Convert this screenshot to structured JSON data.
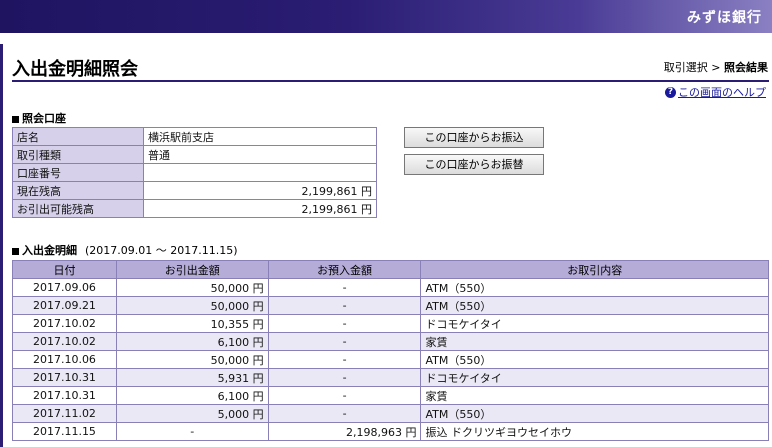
{
  "header": {
    "bank_name": "みずほ銀行"
  },
  "page": {
    "title": "入出金明細照会",
    "breadcrumb_prev": "取引選択",
    "breadcrumb_sep": " > ",
    "breadcrumb_current": "照会結果",
    "help_link": "この画面のヘルプ"
  },
  "account": {
    "heading": "照会口座",
    "rows": [
      {
        "label": "店名",
        "value": ""
      },
      {
        "label": "取引種類",
        "value": ""
      },
      {
        "label": "口座番号",
        "value": ""
      },
      {
        "label": "現在残高",
        "value": "2,199,861 円"
      },
      {
        "label": "お引出可能残高",
        "value": "2,199,861 円"
      }
    ],
    "branch": "横浜駅前支店",
    "type": "普通",
    "number": ""
  },
  "buttons": {
    "transfer_furikomi": "この口座からお振込",
    "transfer_furikae": "この口座からお振替"
  },
  "transactions": {
    "heading": "入出金明細",
    "period": "(2017.09.01 〜 2017.11.15)",
    "columns": [
      "日付",
      "お引出金額",
      "お預入金額",
      "お取引内容"
    ],
    "rows": [
      {
        "date": "2017.09.06",
        "withdrawal": "50,000 円",
        "deposit": "-",
        "desc": "ATM（550）"
      },
      {
        "date": "2017.09.21",
        "withdrawal": "50,000 円",
        "deposit": "-",
        "desc": "ATM（550）"
      },
      {
        "date": "2017.10.02",
        "withdrawal": "10,355 円",
        "deposit": "-",
        "desc": "ドコモケイタイ"
      },
      {
        "date": "2017.10.02",
        "withdrawal": "6,100 円",
        "deposit": "-",
        "desc": "家賃"
      },
      {
        "date": "2017.10.06",
        "withdrawal": "50,000 円",
        "deposit": "-",
        "desc": "ATM（550）"
      },
      {
        "date": "2017.10.31",
        "withdrawal": "5,931 円",
        "deposit": "-",
        "desc": "ドコモケイタイ"
      },
      {
        "date": "2017.10.31",
        "withdrawal": "6,100 円",
        "deposit": "-",
        "desc": "家賃"
      },
      {
        "date": "2017.11.02",
        "withdrawal": "5,000 円",
        "deposit": "-",
        "desc": "ATM（550）"
      },
      {
        "date": "2017.11.15",
        "withdrawal": "-",
        "deposit": "2,198,963 円",
        "desc": "振込 ドクリツギヨウセイホウ"
      }
    ]
  }
}
